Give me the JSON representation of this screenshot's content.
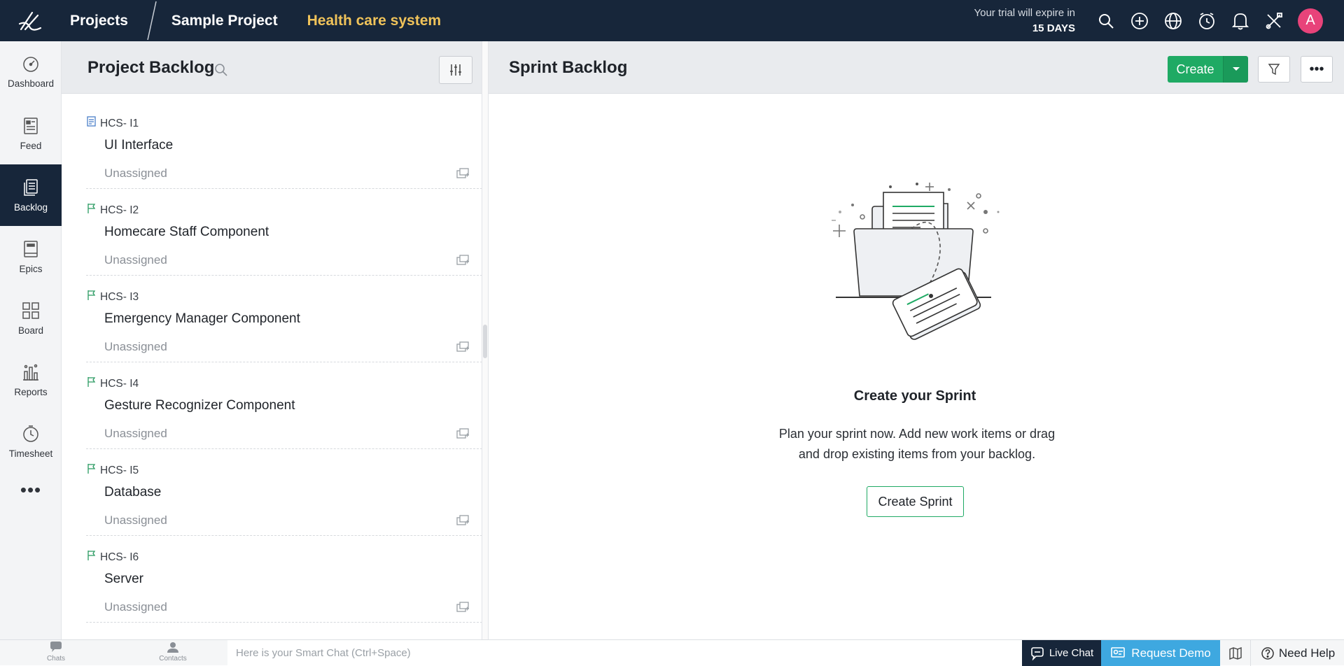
{
  "topbar": {
    "projects_label": "Projects",
    "project_name": "Sample Project",
    "subproject_name": "Health care system",
    "trial_line1": "Your trial will expire in",
    "trial_line2": "15 DAYS",
    "avatar_initial": "A",
    "icons": [
      "search-icon",
      "add-icon",
      "globe-icon",
      "timer-icon",
      "bell-icon",
      "tools-icon"
    ]
  },
  "leftnav": {
    "items": [
      {
        "label": "Dashboard",
        "icon": "dashboard-icon"
      },
      {
        "label": "Feed",
        "icon": "feed-icon"
      },
      {
        "label": "Backlog",
        "icon": "backlog-icon",
        "active": true
      },
      {
        "label": "Epics",
        "icon": "epics-icon"
      },
      {
        "label": "Board",
        "icon": "board-icon"
      },
      {
        "label": "Reports",
        "icon": "reports-icon"
      },
      {
        "label": "Timesheet",
        "icon": "timesheet-icon"
      }
    ],
    "more_label": "•••"
  },
  "project_backlog": {
    "title": "Project Backlog",
    "items": [
      {
        "id": "HCS- I1",
        "name": "UI Interface",
        "assignee": "Unassigned",
        "type_icon": "story-icon"
      },
      {
        "id": "HCS- I2",
        "name": "Homecare Staff Component",
        "assignee": "Unassigned",
        "type_icon": "flag-icon"
      },
      {
        "id": "HCS- I3",
        "name": "Emergency Manager Component",
        "assignee": "Unassigned",
        "type_icon": "flag-icon"
      },
      {
        "id": "HCS- I4",
        "name": "Gesture Recognizer Component",
        "assignee": "Unassigned",
        "type_icon": "flag-icon"
      },
      {
        "id": "HCS- I5",
        "name": "Database",
        "assignee": "Unassigned",
        "type_icon": "flag-icon"
      },
      {
        "id": "HCS- I6",
        "name": "Server",
        "assignee": "Unassigned",
        "type_icon": "flag-icon"
      }
    ]
  },
  "sprint_backlog": {
    "title": "Sprint Backlog",
    "create_label": "Create",
    "more_label": "•••",
    "empty_title": "Create your Sprint",
    "empty_desc_line1": "Plan your sprint now. Add new work items or drag",
    "empty_desc_line2": "and drop existing items from your backlog.",
    "empty_button": "Create Sprint"
  },
  "bottombar": {
    "chats_label": "Chats",
    "contacts_label": "Contacts",
    "smartchat_placeholder": "Here is your Smart Chat (Ctrl+Space)",
    "live_chat_label": "Live Chat",
    "request_demo_label": "Request Demo",
    "need_help_label": "Need Help"
  },
  "colors": {
    "topbar_bg": "#17263a",
    "accent_green": "#1faa64",
    "subproject_yellow": "#f0c35a",
    "avatar_pink": "#e8437a",
    "demo_blue": "#3ea8e0"
  }
}
